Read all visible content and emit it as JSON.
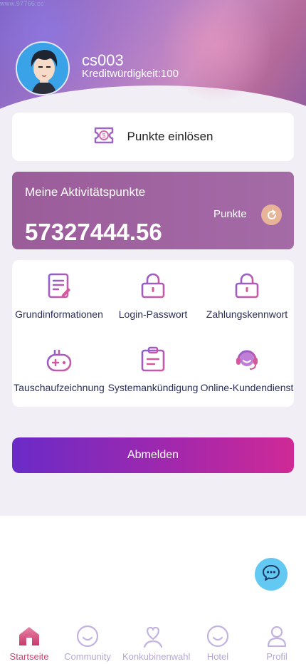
{
  "watermark": "www.97766.cc",
  "profile": {
    "username": "cs003",
    "credit": "Kreditwürdigkeit:100"
  },
  "redeem": {
    "label": "Punkte einlösen",
    "icon": "ticket-icon"
  },
  "points": {
    "title": "Meine Aktivitätspunkte",
    "value": "57327444.56",
    "unit_label": "Punkte",
    "refresh_icon": "refresh-icon"
  },
  "menu": [
    {
      "label": "Grundinformationen",
      "icon": "document-edit-icon"
    },
    {
      "label": "Login-Passwort",
      "icon": "lock-icon"
    },
    {
      "label": "Zahlungskennwort",
      "icon": "lock-icon"
    },
    {
      "label": "Tauschaufzeichnung",
      "icon": "gamepad-icon"
    },
    {
      "label": "Systemankündigung",
      "icon": "clipboard-icon"
    },
    {
      "label": "Online-Kundendienst",
      "icon": "headset-icon"
    }
  ],
  "logout_label": "Abmelden",
  "tabs": [
    {
      "label": "Startseite",
      "icon": "home-icon",
      "active": true
    },
    {
      "label": "Community",
      "icon": "smile-icon",
      "active": false
    },
    {
      "label": "Konkubinenwahl",
      "icon": "heart-person-icon",
      "active": false
    },
    {
      "label": "Hotel",
      "icon": "smile-icon",
      "active": false
    },
    {
      "label": "Profil",
      "icon": "user-icon",
      "active": false
    }
  ],
  "colors": {
    "accent_pink": "#d23f73",
    "tab_inactive": "#b7a6d6",
    "points_card": "#9b5c9a",
    "chat_fab": "#63c9f2"
  }
}
